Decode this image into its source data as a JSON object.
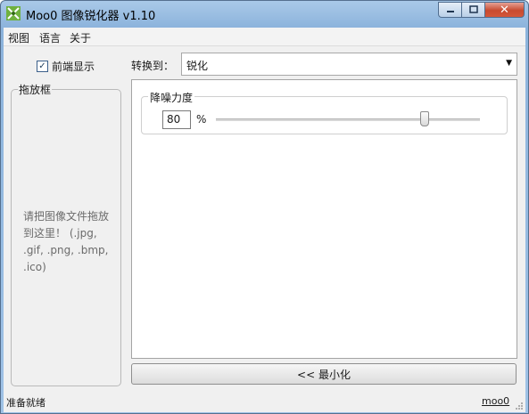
{
  "window": {
    "title": "Moo0 图像锐化器 v1.10",
    "icon": "sharpen-app-icon",
    "controls": {
      "close_label": "✕"
    }
  },
  "menu": {
    "items": [
      {
        "label": "视图"
      },
      {
        "label": "语言"
      },
      {
        "label": "关于"
      }
    ]
  },
  "sidebar": {
    "preview_checkbox": {
      "label": "前端显示",
      "checked": true
    },
    "dropzone": {
      "legend": "拖放框",
      "hint": "请把图像文件拖放到这里！ (.jpg, .gif, .png, .bmp, .ico)"
    }
  },
  "convert": {
    "label": "转换到：",
    "selected": "锐化"
  },
  "noise_reduction": {
    "legend": "降噪力度",
    "value": "80",
    "unit": "%",
    "slider_fraction": 0.8
  },
  "minimize_button": {
    "label": "<< 最小化"
  },
  "status": {
    "text": "准备就绪",
    "link": "moo0"
  },
  "colors": {
    "title_bar": "#9fc2e6",
    "close_button": "#c84a2f",
    "hint_text": "#6b6b6b"
  }
}
